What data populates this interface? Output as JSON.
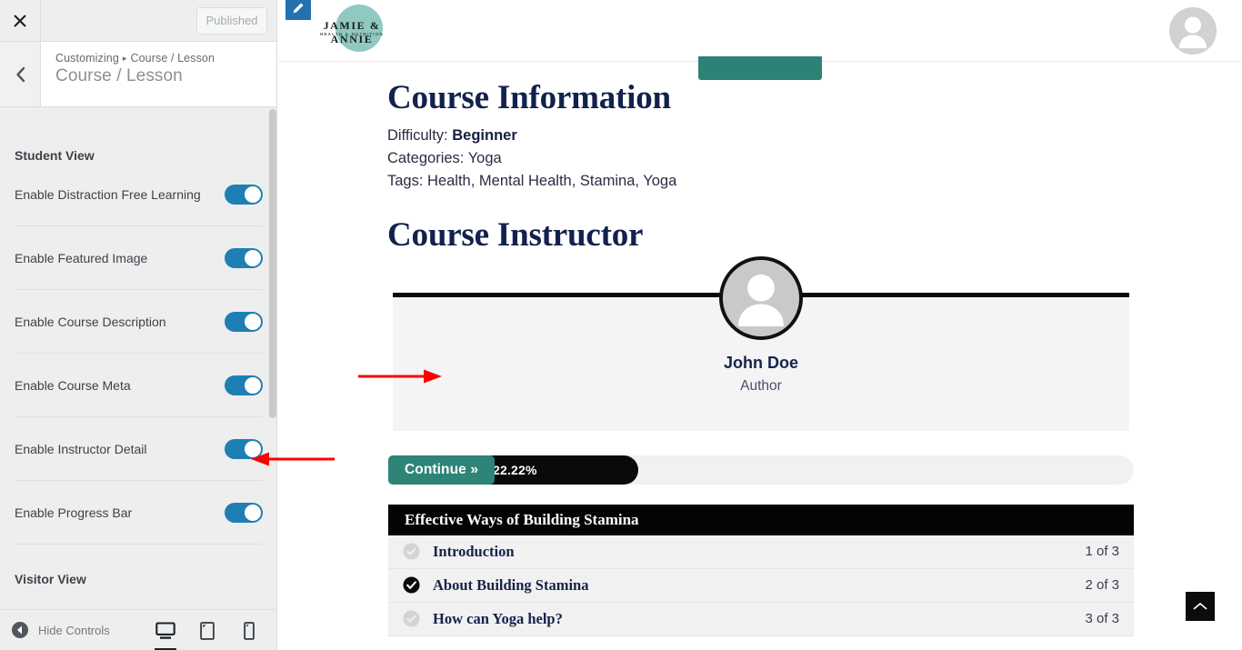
{
  "customizer": {
    "close_label": "Close",
    "publish_label": "Published",
    "breadcrumb_root": "Customizing",
    "breadcrumb_separator": "▸",
    "breadcrumb_current": "Course / Lesson",
    "panel_title": "Course / Lesson",
    "sections": [
      {
        "title": "Student View",
        "rows": [
          {
            "label": "Enable Distraction Free Learning",
            "enabled": true
          },
          {
            "label": "Enable Featured Image",
            "enabled": true
          },
          {
            "label": "Enable Course Description",
            "enabled": true
          },
          {
            "label": "Enable Course Meta",
            "enabled": true
          },
          {
            "label": "Enable Instructor Detail",
            "enabled": true
          },
          {
            "label": "Enable Progress Bar",
            "enabled": true
          }
        ]
      },
      {
        "title": "Visitor View",
        "rows": []
      }
    ],
    "footer": {
      "hide_controls_label": "Hide Controls",
      "devices": [
        {
          "name": "desktop",
          "active": true
        },
        {
          "name": "tablet",
          "active": false
        },
        {
          "name": "mobile",
          "active": false
        }
      ]
    },
    "toggle_on_color": "#1e7fb4"
  },
  "preview": {
    "header": {
      "edit_icon": "pencil-icon",
      "logo_line1": "JAMIE & ANNIE",
      "logo_line2": "HEALTH & NUTRITION",
      "logo_circle_color": "#8fc9c2",
      "avatar_icon": "user-avatar-icon"
    },
    "accent_teal": "#2c8274",
    "course_information": {
      "heading": "Course Information",
      "difficulty_label": "Difficulty:",
      "difficulty_value": "Beginner",
      "categories_label": "Categories:",
      "categories_value": "Yoga",
      "tags_label": "Tags:",
      "tags_value": "Health, Mental Health, Stamina, Yoga"
    },
    "course_instructor": {
      "heading": "Course Instructor",
      "avatar_icon": "user-avatar-icon",
      "name": "John Doe",
      "role": "Author"
    },
    "progress": {
      "continue_label": "Continue »",
      "percent_label": "22.22%",
      "percent_value": 22.22
    },
    "lessons": {
      "title": "Effective Ways of Building Stamina",
      "items": [
        {
          "title": "Introduction",
          "count": "1 of 3",
          "completed": false
        },
        {
          "title": "About Building  Stamina",
          "count": "2 of 3",
          "completed": true
        },
        {
          "title": "How can Yoga help?",
          "count": "3 of 3",
          "completed": false
        }
      ]
    },
    "back_to_top_icon": "chevron-up-icon"
  }
}
